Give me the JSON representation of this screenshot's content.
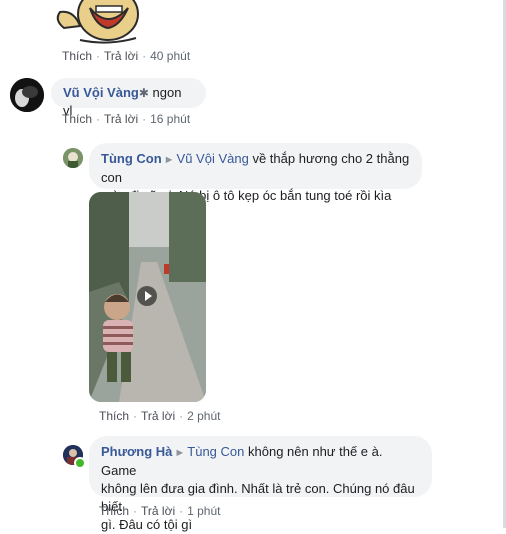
{
  "actions": {
    "like": "Thích",
    "reply": "Trả lời",
    "separator": "·"
  },
  "top_comment": {
    "time": "40 phút"
  },
  "comment_vu": {
    "author": "Vũ Vội Vàng",
    "badge_icon": "star-badge-icon",
    "text": "ngon vl",
    "time": "16 phút"
  },
  "reply_tung": {
    "author": "Tùng Con",
    "reply_to": "Vũ Vội Vàng",
    "text_line1": "về thắp hương cho 2 thằng con",
    "text_line2": "mày đi vũ ơi. Nó bị ô tô kẹp óc bắn tung toé rồi kìa",
    "time": "2 phút",
    "attachment_icon": "play-video-icon"
  },
  "reply_phuong": {
    "author": "Phương Hà",
    "reply_to": "Tùng Con",
    "text_line1": "không nên như thế e à. Game",
    "text_line2": "không lên đưa gia đình. Nhất là trẻ con. Chúng nó đâu biết",
    "text_line3": "gì. Đâu có tội gì",
    "time": "1 phút"
  },
  "colors": {
    "link": "#385898",
    "bubble": "#f2f3f5",
    "meta": "#606770",
    "online": "#42b72a"
  }
}
